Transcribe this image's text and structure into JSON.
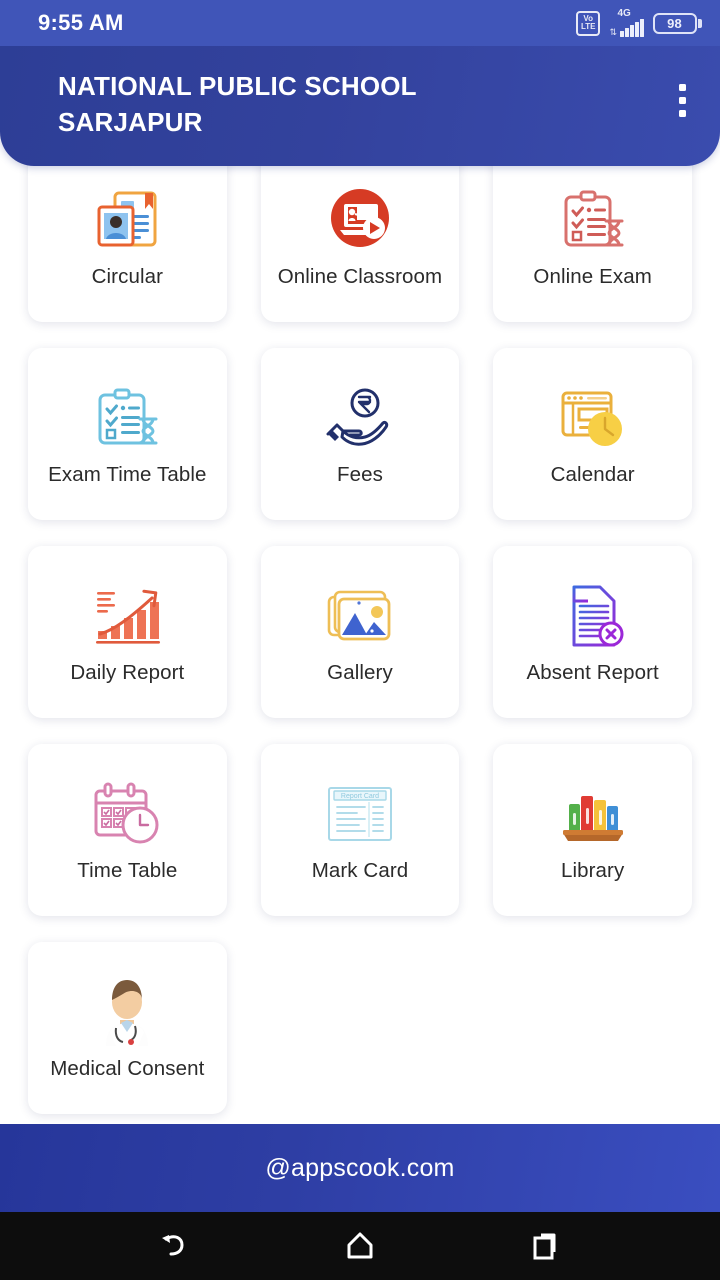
{
  "status_bar": {
    "time": "9:55 AM",
    "volte_label_top": "Vo",
    "volte_label_bottom": "LTE",
    "network_type": "4G",
    "battery_percent": "98"
  },
  "app_bar": {
    "title": "NATIONAL PUBLIC SCHOOL SARJAPUR",
    "overflow_menu_icon": "kebab-menu-icon"
  },
  "theme": {
    "status_bar_color": "#4055b8",
    "app_bar_color": "#2d3e96",
    "footer_color": "#26369a",
    "tile_background": "#ffffff",
    "label_color": "#2b2b2b",
    "nav_bar_color": "#0d0d0d"
  },
  "menu": {
    "tiles": [
      {
        "label": "Circular",
        "icon": "circular-document-icon",
        "color": "#e8833a"
      },
      {
        "label": "Online Classroom",
        "icon": "online-classroom-icon",
        "color": "#d63b24"
      },
      {
        "label": "Online Exam",
        "icon": "online-exam-icon",
        "color": "#d8716d"
      },
      {
        "label": "Exam Time Table",
        "icon": "exam-time-table-icon",
        "color": "#6ec2e0"
      },
      {
        "label": "Fees",
        "icon": "fees-rupee-hand-icon",
        "color": "#22306b"
      },
      {
        "label": "Calendar",
        "icon": "calendar-clock-icon",
        "color": "#f0b429"
      },
      {
        "label": "Daily Report",
        "icon": "daily-report-chart-icon",
        "color": "#ec6a4c"
      },
      {
        "label": "Gallery",
        "icon": "gallery-photos-icon",
        "color": "#3f63cf"
      },
      {
        "label": "Absent Report",
        "icon": "absent-report-icon",
        "color": "#8b2fd0"
      },
      {
        "label": "Time Table",
        "icon": "time-table-icon",
        "color": "#d883b0"
      },
      {
        "label": "Mark Card",
        "icon": "mark-card-icon",
        "color": "#a8d8e8"
      },
      {
        "label": "Library",
        "icon": "library-books-icon",
        "color": "#e03b34"
      },
      {
        "label": "Medical Consent",
        "icon": "medical-consent-icon",
        "color": "#d9a57a"
      }
    ]
  },
  "footer": {
    "text": "@appscook.com"
  },
  "nav_bar": {
    "back_icon": "back-arrow-icon",
    "home_icon": "home-icon",
    "recents_icon": "recent-apps-icon"
  }
}
